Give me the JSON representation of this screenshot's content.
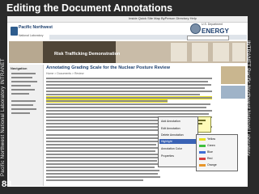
{
  "slide": {
    "title": "Editing the Document Annotations",
    "left_edge_text": "Pacific Northwest National Laboratory INTRANET",
    "right_edge_text": "INTRANET Pacific Northwest National Laboratory",
    "page_number": "88"
  },
  "browser": {
    "top_links": "Inside Quick Site Map ByPerson Directory Help",
    "org_name": "Pacific Northwest",
    "org_sub": "National Laboratory",
    "doe_line1": "U.S. Department",
    "doe_line2": "of Energy",
    "doe_word": "ENERGY",
    "banner_text": "Risk Trafficking Demonstration",
    "nav_heading": "Navigation",
    "doc_title": "Annotating Grading Scale for the Nuclear Posture Review",
    "breadcrumb": "Home > Documents > Review"
  },
  "context_menu": {
    "items": [
      "Add Annotation",
      "Edit Annotation",
      "Delete Annotation",
      "Highlight",
      "Annotation Color",
      "Properties"
    ]
  },
  "submenu": {
    "items": [
      "Yellow",
      "Green",
      "Blue",
      "Red",
      "Orange"
    ]
  },
  "colors": {
    "slide_frame": "#2a2a2a",
    "highlight": "#e8e020",
    "note_bg": "#fffbb8",
    "menu_selection": "#3a63b5",
    "accent_blue": "#1c3f6e"
  }
}
